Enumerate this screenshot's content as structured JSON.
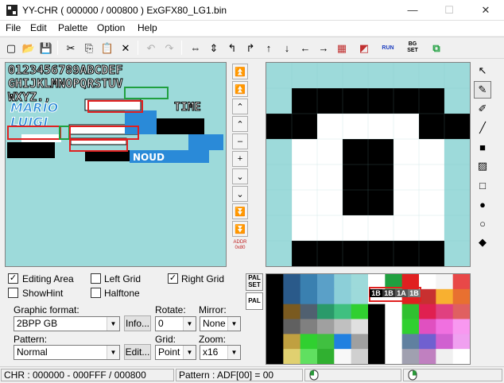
{
  "window": {
    "title": "YY-CHR ( 000000 / 000800 ) ExGFX80_LG1.bin",
    "minimize": "—",
    "maximize": "☐",
    "close": "✕"
  },
  "menu": [
    "File",
    "Edit",
    "Palette",
    "Option",
    "Help"
  ],
  "toolbar": [
    {
      "name": "new-icon",
      "glyph": "▢"
    },
    {
      "name": "open-icon",
      "glyph": "📂"
    },
    {
      "name": "save-icon",
      "glyph": "💾"
    },
    {
      "name": "cut-icon",
      "glyph": "✂"
    },
    {
      "name": "copy-icon",
      "glyph": "⎘"
    },
    {
      "name": "paste-icon",
      "glyph": "📋"
    },
    {
      "name": "delete-icon",
      "glyph": "✕"
    },
    {
      "name": "undo-icon",
      "glyph": "↶"
    },
    {
      "name": "redo-icon",
      "glyph": "↷"
    },
    {
      "name": "flip-horizontal-icon",
      "glyph": "⇔"
    },
    {
      "name": "flip-vertical-icon",
      "glyph": "⇕"
    },
    {
      "name": "rotate-left-icon",
      "glyph": "↰"
    },
    {
      "name": "rotate-right-icon",
      "glyph": "↱"
    },
    {
      "name": "shift-up-icon",
      "glyph": "↑"
    },
    {
      "name": "shift-down-icon",
      "glyph": "↓"
    },
    {
      "name": "shift-left-icon",
      "glyph": "←"
    },
    {
      "name": "shift-right-icon",
      "glyph": "→"
    },
    {
      "name": "palette-grid-icon",
      "glyph": "▦"
    },
    {
      "name": "replace-color-icon",
      "glyph": "◩"
    },
    {
      "name": "run-icon",
      "glyph": "RUN"
    },
    {
      "name": "bg-set-icon",
      "glyph": "BG SET"
    },
    {
      "name": "export-icon",
      "glyph": "⧉"
    }
  ],
  "address_buttons": [
    "⏫",
    "⏫",
    "⌃",
    "⌃",
    "–",
    "+",
    "⌄",
    "⌄",
    "⏬",
    "⏬"
  ],
  "address_label": "ADDR 0x80",
  "tools": [
    {
      "name": "pointer-icon",
      "glyph": "↖"
    },
    {
      "name": "pen-icon",
      "glyph": "✎"
    },
    {
      "name": "brush-icon",
      "glyph": "✐"
    },
    {
      "name": "line-icon",
      "glyph": "╱"
    },
    {
      "name": "filled-rect-icon",
      "glyph": "■"
    },
    {
      "name": "pattern-fill-icon",
      "glyph": "▨"
    },
    {
      "name": "rect-icon",
      "glyph": "□"
    },
    {
      "name": "filled-circle-icon",
      "glyph": "●"
    },
    {
      "name": "circle-icon",
      "glyph": "○"
    },
    {
      "name": "bucket-fill-icon",
      "glyph": "◆"
    }
  ],
  "options": {
    "editing_area": {
      "label": "Editing Area",
      "checked": true
    },
    "left_grid": {
      "label": "Left Grid",
      "checked": false
    },
    "right_grid": {
      "label": "Right Grid",
      "checked": true
    },
    "show_hint": {
      "label": "ShowHint",
      "checked": false
    },
    "halftone": {
      "label": "Halftone",
      "checked": false
    }
  },
  "graphic_format": {
    "label": "Graphic format:",
    "value": "2BPP GB",
    "info_button": "Info..."
  },
  "rotate": {
    "label": "Rotate:",
    "value": "0"
  },
  "mirror": {
    "label": "Mirror:",
    "value": "None"
  },
  "pattern": {
    "label": "Pattern:",
    "value": "Normal",
    "edit_button": "Edit..."
  },
  "grid": {
    "label": "Grid:",
    "value": "Point"
  },
  "zoom": {
    "label": "Zoom:",
    "value": "x16"
  },
  "pal_tabs": {
    "pal_set": "PAL SET",
    "pal": "PAL"
  },
  "palette_labels": [
    "1B",
    "1B",
    "1A",
    "1B"
  ],
  "status": {
    "chr": "CHR : 000000 - 000FFF / 000800",
    "pattern": "Pattern : ADF[00] = 00"
  },
  "colors": {
    "canvas_bg": "#9ddada",
    "sprite_blue": "#2a8ad8",
    "selection_red": "#e02020",
    "selection_green": "#20a040"
  }
}
